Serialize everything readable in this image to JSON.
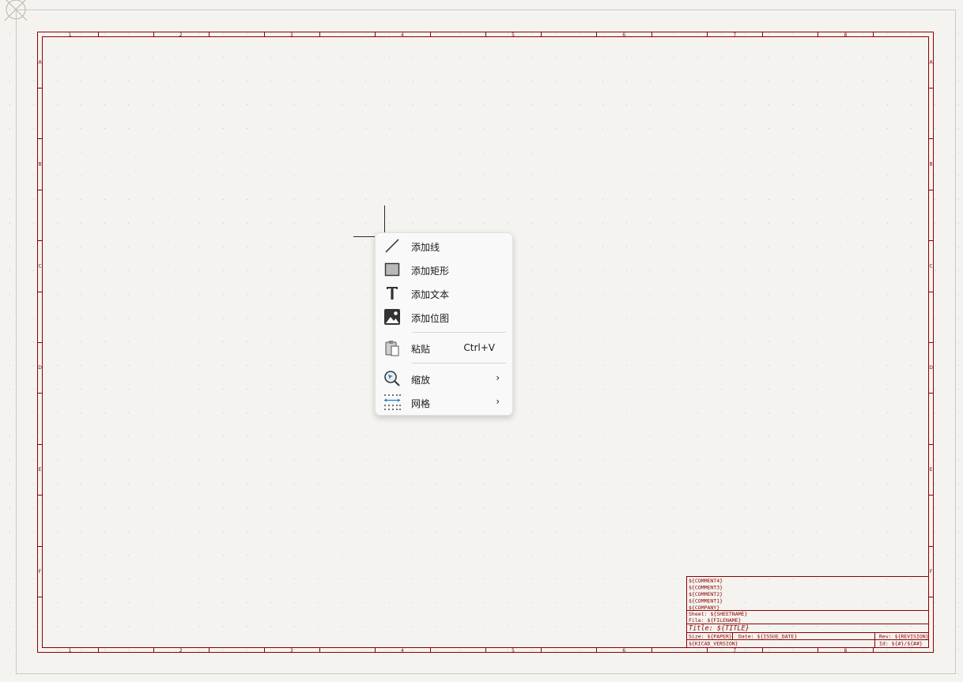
{
  "sheet": {
    "column_labels": [
      "1",
      "2",
      "3",
      "4",
      "5",
      "6",
      "7",
      "8"
    ],
    "row_labels": [
      "A",
      "B",
      "C",
      "D",
      "E",
      "F"
    ],
    "title_block": {
      "comments": [
        "${COMMENT4}",
        "${COMMENT3}",
        "${COMMENT2}",
        "${COMMENT1}"
      ],
      "company": "${COMPANY}",
      "sheet": "Sheet: ${SHEETNAME}",
      "file": "File: ${FILENAME}",
      "title": "Title: ${TITLE}",
      "size": "Size: ${PAPER}",
      "date": "Date: ${ISSUE_DATE}",
      "rev": "Rev: ${REVISION}",
      "kicad": "${KICAD_VERSION}",
      "id": "Id: ${#}/${##}"
    }
  },
  "context_menu": {
    "items": [
      {
        "label": "添加线",
        "icon": "line-icon"
      },
      {
        "label": "添加矩形",
        "icon": "rectangle-icon"
      },
      {
        "label": "添加文本",
        "icon": "text-icon"
      },
      {
        "label": "添加位图",
        "icon": "image-icon"
      },
      {
        "label": "粘贴",
        "icon": "paste-icon",
        "shortcut": "Ctrl+V"
      },
      {
        "label": "缩放",
        "icon": "zoom-icon",
        "submenu_arrow": "›"
      },
      {
        "label": "网格",
        "icon": "grid-icon",
        "submenu_arrow": "›"
      }
    ]
  },
  "colors": {
    "border": "#8b0000",
    "background": "#f4f3ef",
    "grid_dot": "#c9c6bd"
  }
}
